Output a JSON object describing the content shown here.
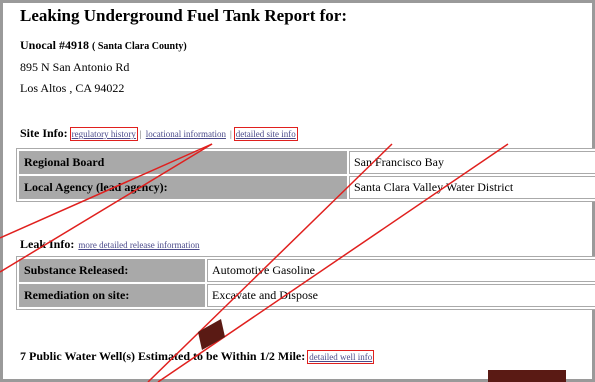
{
  "header": {
    "title": "Leaking Underground Fuel Tank Report for:",
    "site_name": "Unocal #4918",
    "county": "( Santa Clara County)",
    "address_line1": "895 N San Antonio Rd",
    "address_line2": "Los Altos , CA 94022"
  },
  "site_info": {
    "label": "Site Info:",
    "links": [
      "regulatory history",
      "locational information",
      "detailed site info"
    ],
    "separator": "|",
    "rows": [
      {
        "key": "Regional Board",
        "value": "San Francisco Bay"
      },
      {
        "key": "Local Agency (lead agency):",
        "value": "Santa Clara Valley Water District"
      }
    ]
  },
  "leak_info": {
    "label": "Leak Info:",
    "link": "more detailed release information",
    "rows": [
      {
        "key": "Substance Released:",
        "value": "Automotive Gasoline"
      },
      {
        "key": "Remediation on site:",
        "value": "Excavate and Dispose"
      }
    ]
  },
  "water_wells": {
    "text": "7 Public Water Well(s) Estimated to be Within 1/2 Mile:",
    "link": "detailed well info"
  },
  "annotation": {
    "highlight_color": "#e0201e",
    "bar_color": "#5a1a14"
  }
}
